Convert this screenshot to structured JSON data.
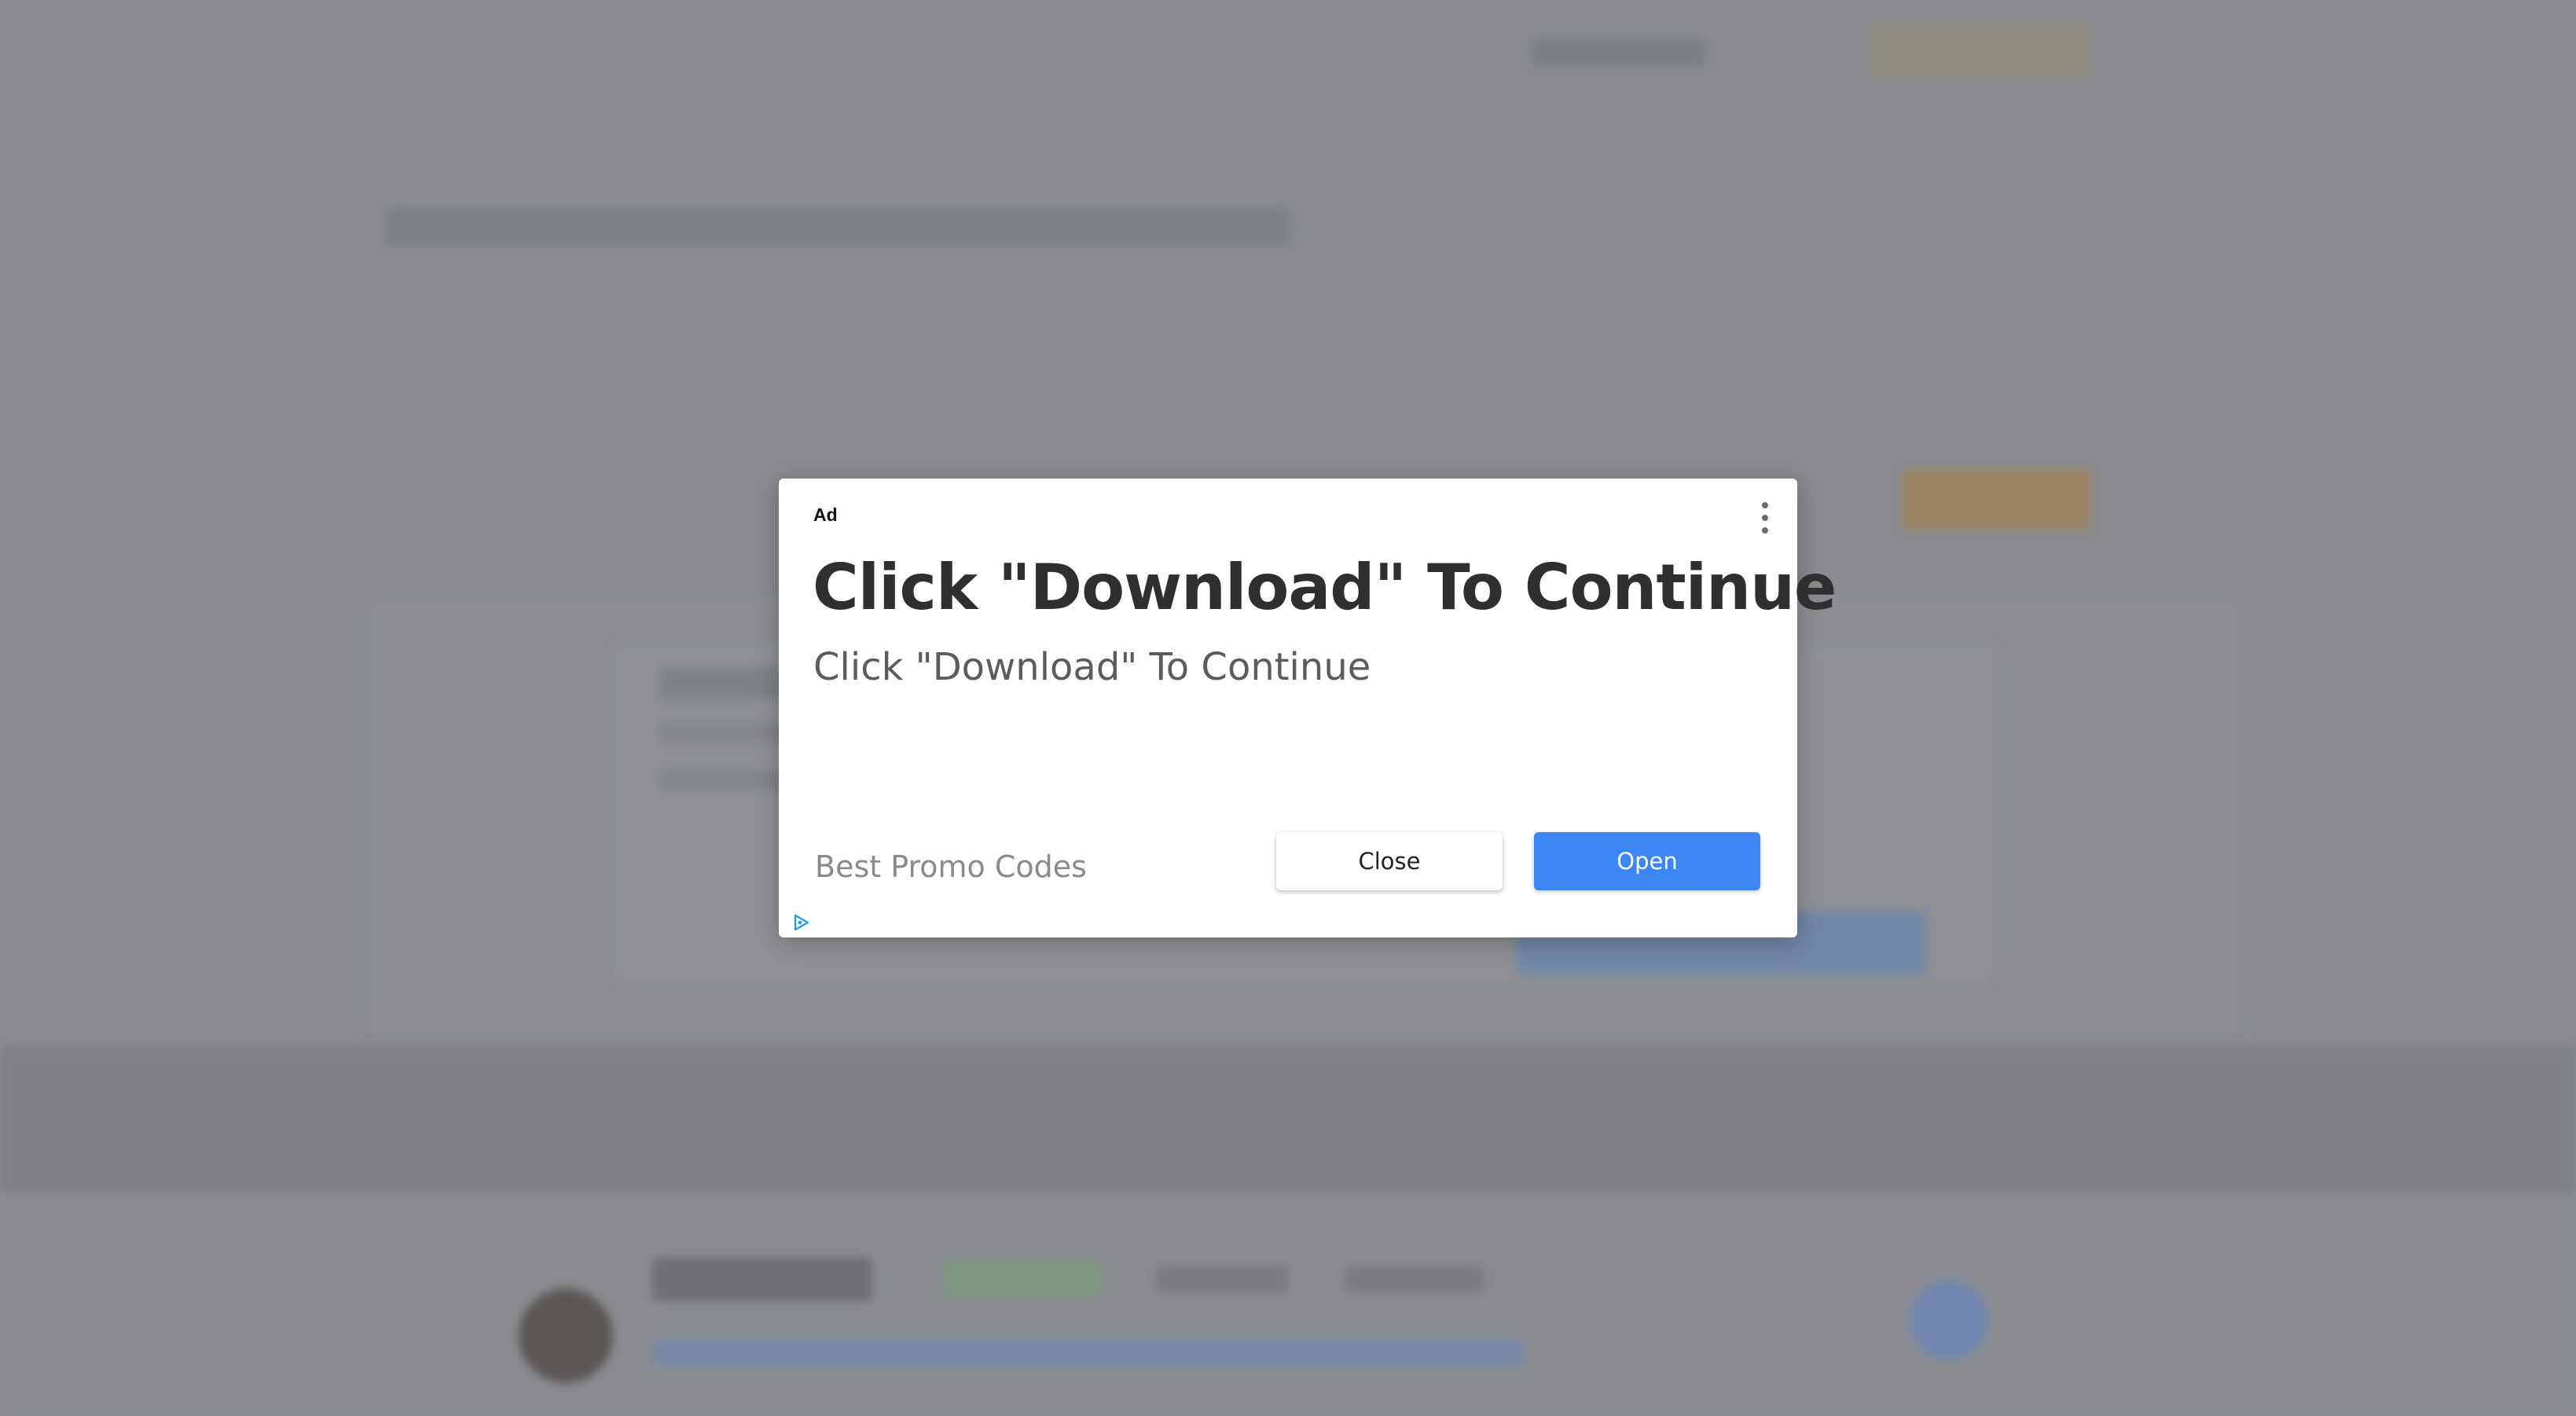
{
  "ad": {
    "label": "Ad",
    "menu_icon": "more-vert-icon",
    "headline": "Click \"Download\" To Continue",
    "subtext": "Click \"Download\" To Continue",
    "advertiser": "Best Promo Codes",
    "close_label": "Close",
    "open_label": "Open",
    "adchoices_icon": "adchoices-icon",
    "colors": {
      "open_button": "#3d87f5",
      "backdrop": "#888a8e",
      "adchoices": "#2b9bd6"
    }
  }
}
